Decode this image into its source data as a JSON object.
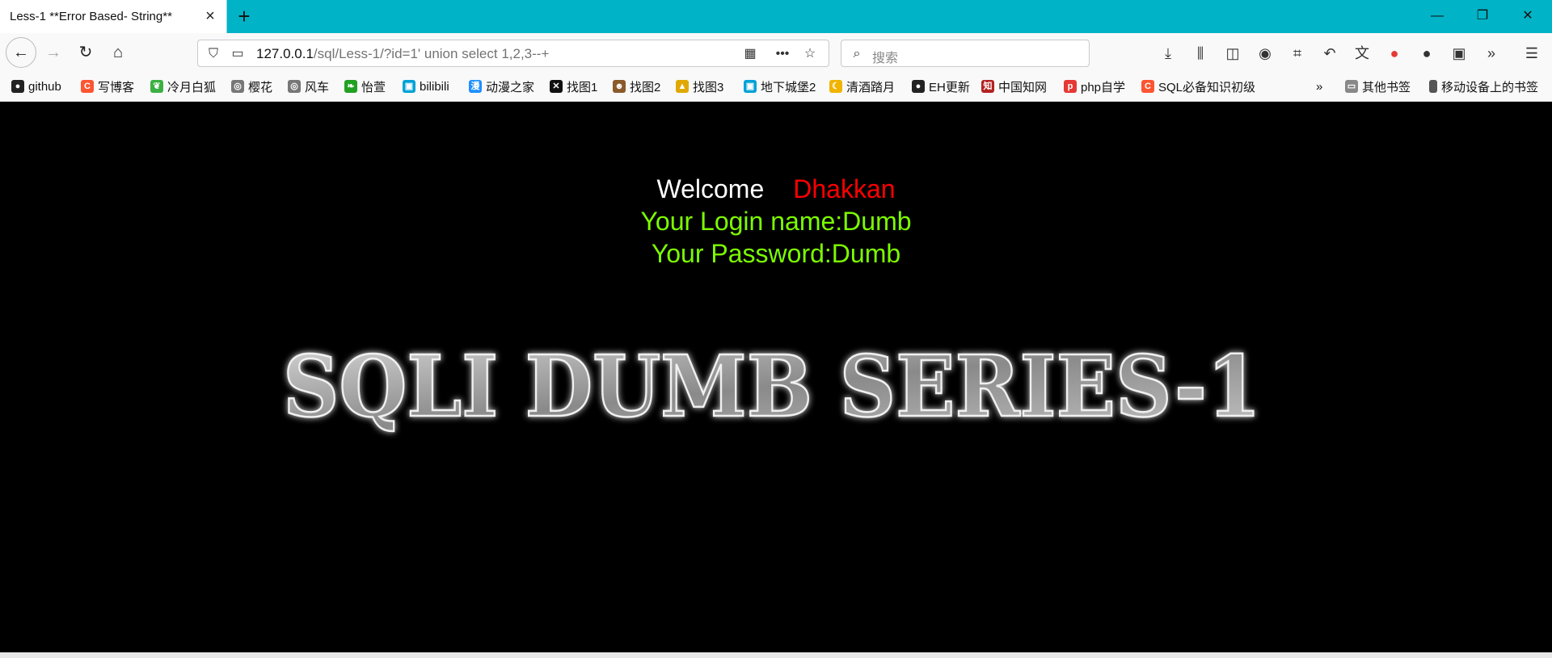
{
  "tab": {
    "title": "Less-1 **Error Based- String**"
  },
  "window_controls": {
    "minimize": "—",
    "restore": "❐",
    "close": "✕"
  },
  "nav": {
    "url_host": "127.0.0.1",
    "url_rest": "/sql/Less-1/?id=1' union select 1,2,3--+",
    "search_placeholder": "搜索"
  },
  "bookmarks": [
    {
      "label": "github",
      "icon": "github-icon",
      "color": "#222222",
      "glyph": "●"
    },
    {
      "label": "写博客",
      "icon": "csdn-icon",
      "color": "#fc5531",
      "glyph": "C"
    },
    {
      "label": "冷月白狐",
      "icon": "leaf-icon",
      "color": "#3cb043",
      "glyph": "❦"
    },
    {
      "label": "樱花",
      "icon": "globe-icon",
      "color": "#777777",
      "glyph": "◎"
    },
    {
      "label": "风车",
      "icon": "globe-icon",
      "color": "#777777",
      "glyph": "◎"
    },
    {
      "label": "怡萱",
      "icon": "green-leaf-icon",
      "color": "#22a022",
      "glyph": "❧"
    },
    {
      "label": "bilibili",
      "icon": "bilibili-icon",
      "color": "#00a1d6",
      "glyph": "▣"
    },
    {
      "label": "动漫之家",
      "icon": "manga-icon",
      "color": "#1e90ff",
      "glyph": "漫"
    },
    {
      "label": "找图1",
      "icon": "x-icon",
      "color": "#111111",
      "glyph": "✕"
    },
    {
      "label": "找图2",
      "icon": "avatar-icon",
      "color": "#8b5a2b",
      "glyph": "☻"
    },
    {
      "label": "找图3",
      "icon": "image-icon",
      "color": "#e0a800",
      "glyph": "▲"
    },
    {
      "label": "地下城堡2",
      "icon": "bilibili-icon",
      "color": "#00a1d6",
      "glyph": "▣"
    },
    {
      "label": "清酒踏月",
      "icon": "moon-icon",
      "color": "#f0b400",
      "glyph": "☾"
    },
    {
      "label": "EH更新",
      "icon": "github-icon",
      "color": "#222222",
      "glyph": "●"
    },
    {
      "label": "中国知网",
      "icon": "cnki-icon",
      "color": "#b22222",
      "glyph": "知"
    },
    {
      "label": "php自学",
      "icon": "php-icon",
      "color": "#e53935",
      "glyph": "p"
    },
    {
      "label": "SQL必备知识初级",
      "icon": "csdn-icon",
      "color": "#fc5531",
      "glyph": "C"
    }
  ],
  "bookmarks_right": [
    {
      "label": "其他书签",
      "icon": "folder-icon"
    },
    {
      "label": "移动设备上的书签",
      "icon": "mobile-icon"
    }
  ],
  "page": {
    "welcome": "Welcome",
    "user": "Dhakkan",
    "login_name": "Your Login name:Dumb",
    "password": "Your Password:Dumb",
    "banner": "SQLI DUMB SERIES-1"
  },
  "colors": {
    "tabbar": "#00b3c6",
    "welcome": "#ffffff",
    "user": "#ff0000",
    "info": "#7cfc00",
    "page_bg": "#000000"
  }
}
